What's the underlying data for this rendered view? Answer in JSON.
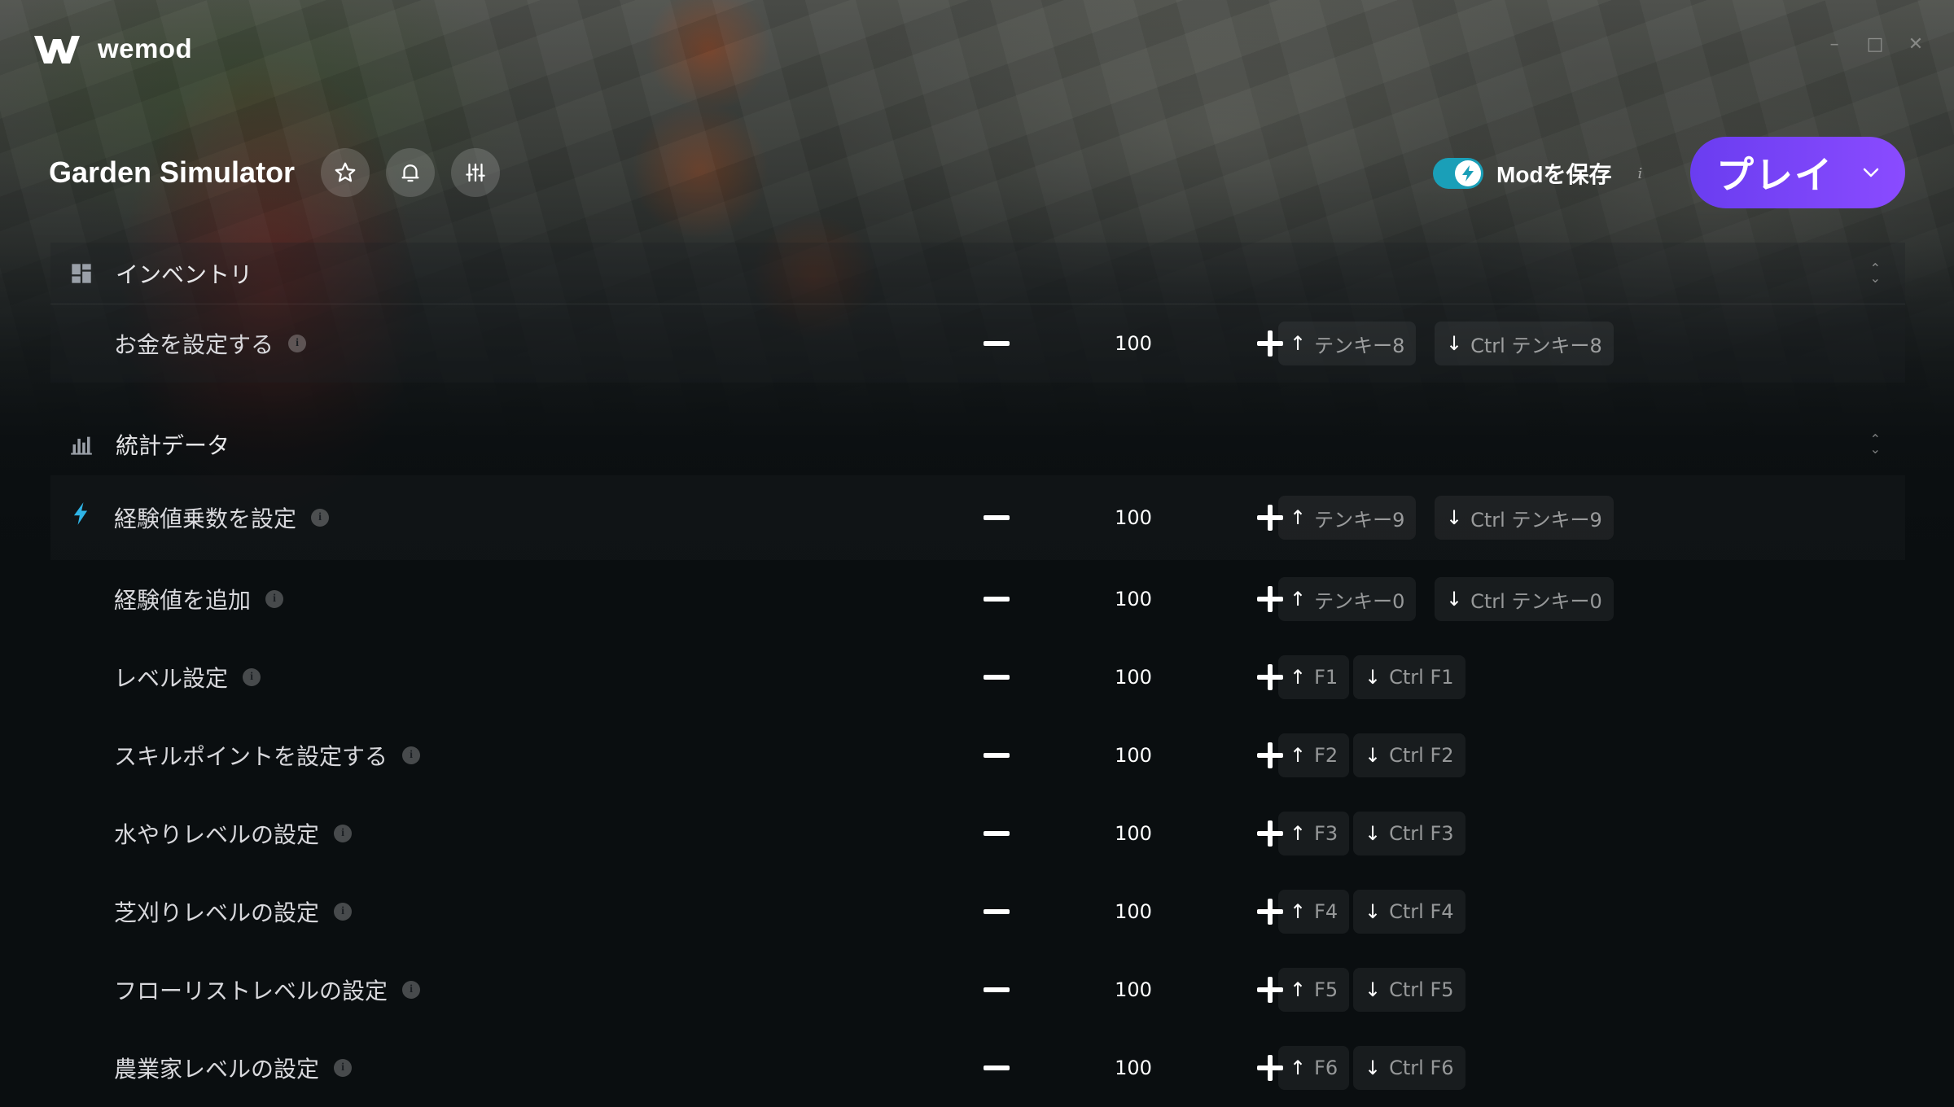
{
  "app": {
    "name": "wemod"
  },
  "game": {
    "title": "Garden Simulator"
  },
  "header": {
    "save_mods_label": "Modを保存",
    "save_mods_info": "i",
    "save_mods_enabled": true,
    "play_label": "プレイ"
  },
  "sections": [
    {
      "title": "インベントリ",
      "icon": "grid-icon",
      "rows": [
        {
          "label": "お金を設定する",
          "value": "100",
          "inc_key": "テンキー8",
          "dec_key": "Ctrl テンキー8"
        }
      ]
    },
    {
      "title": "統計データ",
      "icon": "bar-chart-icon",
      "rows": [
        {
          "label": "経験値乗数を設定",
          "value": "100",
          "inc_key": "テンキー9",
          "dec_key": "Ctrl テンキー9",
          "featured": true
        },
        {
          "label": "経験値を追加",
          "value": "100",
          "inc_key": "テンキー0",
          "dec_key": "Ctrl テンキー0"
        },
        {
          "label": "レベル設定",
          "value": "100",
          "inc_key": "F1",
          "dec_key": "Ctrl F1"
        },
        {
          "label": "スキルポイントを設定する",
          "value": "100",
          "inc_key": "F2",
          "dec_key": "Ctrl F2"
        },
        {
          "label": "水やりレベルの設定",
          "value": "100",
          "inc_key": "F3",
          "dec_key": "Ctrl F3"
        },
        {
          "label": "芝刈りレベルの設定",
          "value": "100",
          "inc_key": "F4",
          "dec_key": "Ctrl F4"
        },
        {
          "label": "フローリストレベルの設定",
          "value": "100",
          "inc_key": "F5",
          "dec_key": "Ctrl F5"
        },
        {
          "label": "農業家レベルの設定",
          "value": "100",
          "inc_key": "F6",
          "dec_key": "Ctrl F6"
        }
      ]
    }
  ],
  "colors": {
    "accent": "#7b46f8",
    "toggle": "#1a9fb8",
    "bolt": "#2fb4e6"
  }
}
